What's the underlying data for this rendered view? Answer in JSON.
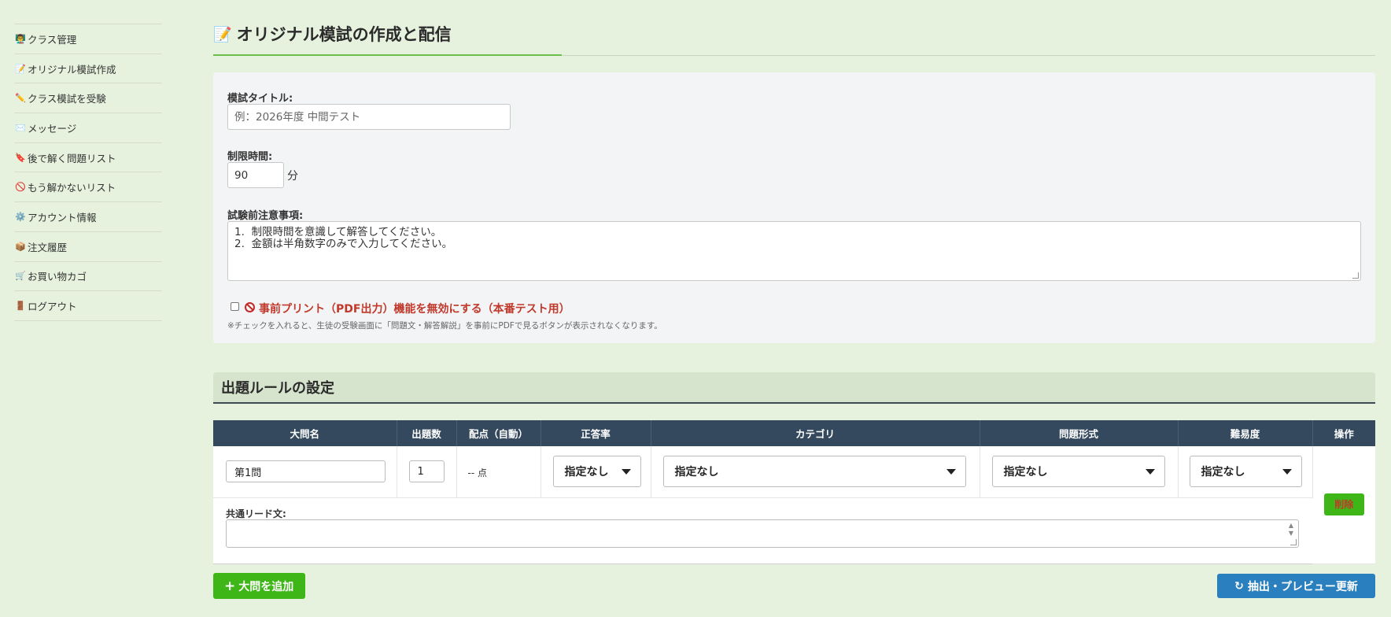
{
  "sidebar": {
    "items": [
      {
        "icon": "teacher-icon",
        "glyph": "👨‍🏫",
        "label": "クラス管理"
      },
      {
        "icon": "memo-icon",
        "glyph": "📝",
        "label": "オリジナル模試作成"
      },
      {
        "icon": "pencil-icon",
        "glyph": "✏️",
        "label": "クラス模試を受験"
      },
      {
        "icon": "envelope-icon",
        "glyph": "✉️",
        "label": "メッセージ"
      },
      {
        "icon": "bookmark-icon",
        "glyph": "🔖",
        "label": "後で解く問題リスト"
      },
      {
        "icon": "prohibited-icon",
        "glyph": "🚫",
        "label": "もう解かないリスト"
      },
      {
        "icon": "gear-icon",
        "glyph": "⚙️",
        "label": "アカウント情報"
      },
      {
        "icon": "package-icon",
        "glyph": "📦",
        "label": "注文履歴"
      },
      {
        "icon": "cart-icon",
        "glyph": "🛒",
        "label": "お買い物カゴ"
      },
      {
        "icon": "door-icon",
        "glyph": "🚪",
        "label": "ログアウト"
      }
    ]
  },
  "page": {
    "title_icon": "📝",
    "title": "オリジナル模試の作成と配信"
  },
  "form": {
    "title_label": "模試タイトル:",
    "title_placeholder": "例：2026年度 中間テスト",
    "time_label": "制限時間:",
    "time_value": "90",
    "time_unit": "分",
    "notes_label": "試験前注意事項:",
    "notes_value": "1.  制限時間を意識して解答してください。\n2.  金額は半角数字のみで入力してください。",
    "disable_print_checked": false,
    "disable_print_label": "事前プリント（PDF出力）機能を無効にする（本番テスト用）",
    "disable_print_note": "※チェックを入れると、生徒の受験画面に「問題文・解答解説」を事前にPDFで見るボタンが表示されなくなります。"
  },
  "rules": {
    "heading": "出題ルールの設定",
    "columns": [
      "大問名",
      "出題数",
      "配点（自動）",
      "正答率",
      "カテゴリ",
      "問題形式",
      "難易度",
      "操作"
    ],
    "rows": [
      {
        "name": "第1問",
        "count": "1",
        "points": "-- 点",
        "accuracy": "指定なし",
        "category": "指定なし",
        "format": "指定なし",
        "difficulty": "指定なし",
        "lead_label": "共通リード文:",
        "lead_text": "",
        "delete_label": "削除"
      }
    ]
  },
  "actions": {
    "add_label": "大問を追加",
    "preview_label": "抽出・プレビュー更新"
  },
  "colors": {
    "background": "#e6f2de",
    "accent_green": "#3fb618",
    "table_header": "#34495e",
    "preview_blue": "#2a7fbe",
    "warning_red": "#c0392b"
  }
}
